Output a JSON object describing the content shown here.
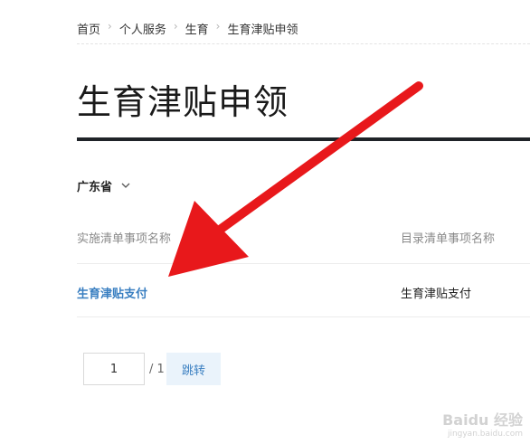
{
  "breadcrumb": {
    "items": [
      "首页",
      "个人服务",
      "生育",
      "生育津贴申领"
    ],
    "separator": "›"
  },
  "page_title": "生育津贴申领",
  "filter": {
    "province": "广东省",
    "dropdown_icon": "chevron-down-icon"
  },
  "table": {
    "headers": [
      "实施清单事项名称",
      "目录清单事项名称"
    ],
    "rows": [
      [
        "生育津贴支付",
        "生育津贴支付"
      ]
    ]
  },
  "pagination": {
    "current_page": "1",
    "total": "/ 1",
    "jump_label": "跳转"
  },
  "annotation": {
    "arrow_color": "#e8181b"
  },
  "watermark": {
    "main": "Baidu 经验",
    "sub": "jingyan.baidu.com"
  },
  "colors": {
    "link": "#3a7fc1",
    "title_rule": "#1f2328",
    "jump_button_bg": "#eaf3fb"
  }
}
